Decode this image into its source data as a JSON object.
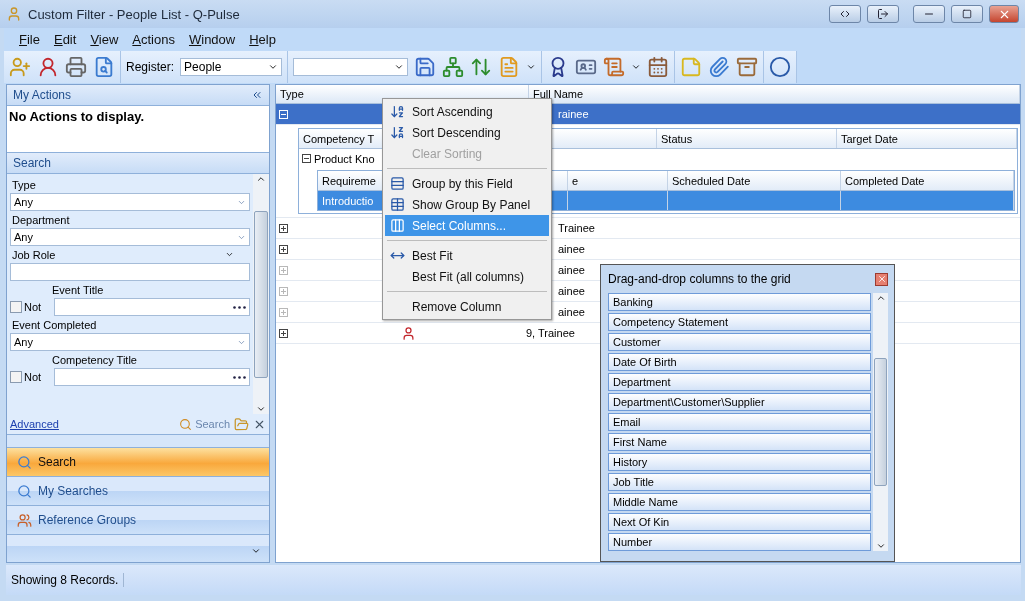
{
  "window": {
    "title": "Custom Filter - People List - Q-Pulse"
  },
  "menu": [
    {
      "label": "File"
    },
    {
      "label": "Edit"
    },
    {
      "label": "View"
    },
    {
      "label": "Actions"
    },
    {
      "label": "Window"
    },
    {
      "label": "Help"
    }
  ],
  "toolbar": {
    "register_label": "Register:",
    "register_value": "People"
  },
  "my_actions": {
    "title": "My Actions",
    "message": "No Actions to display."
  },
  "search_panel": {
    "title": "Search",
    "fields": [
      {
        "kind": "dropdown",
        "label": "Type",
        "value": "Any"
      },
      {
        "kind": "dropdown",
        "label": "Department",
        "value": "Any"
      },
      {
        "kind": "text",
        "label": "Job Role"
      },
      {
        "kind": "lookup",
        "label": "Event Title",
        "not_label": "Not",
        "not_checked": false
      },
      {
        "kind": "dropdown",
        "label": "Event Completed",
        "value": "Any"
      },
      {
        "kind": "lookup",
        "label": "Competency Title",
        "not_label": "Not",
        "not_checked": false
      }
    ],
    "advanced": "Advanced",
    "search_button": "Search"
  },
  "navigation": [
    {
      "label": "Search",
      "selected": true
    },
    {
      "label": "My Searches",
      "selected": false
    },
    {
      "label": "Reference Groups",
      "selected": false
    }
  ],
  "grid": {
    "columns": [
      "Type",
      "Full Name"
    ],
    "rows": [
      {
        "expanded": true,
        "dimmed": false,
        "selected": true,
        "full_name": "rainee"
      },
      {
        "expanded": false,
        "dimmed": false,
        "selected": false,
        "full_name": "Trainee"
      },
      {
        "expanded": false,
        "dimmed": false,
        "selected": false,
        "full_name": "ainee"
      },
      {
        "expanded": false,
        "dimmed": true,
        "selected": false,
        "full_name": "ainee"
      },
      {
        "expanded": false,
        "dimmed": true,
        "selected": false,
        "full_name": "ainee"
      },
      {
        "expanded": false,
        "dimmed": true,
        "selected": false,
        "full_name": "ainee"
      },
      {
        "expanded": false,
        "dimmed": false,
        "selected": false,
        "full_name": "9, Trainee"
      }
    ],
    "detail": {
      "columns": [
        "Competency T",
        "Status",
        "Target Date"
      ],
      "group": {
        "label": "Product Kno",
        "expanded": true
      },
      "inner_columns": [
        "Requireme",
        "e",
        "Scheduled Date",
        "Completed Date"
      ],
      "inner_rows": [
        {
          "cells": [
            "Introductio"
          ],
          "selected": true
        }
      ]
    }
  },
  "context_menu": {
    "groups": [
      [
        {
          "label": "Sort Ascending",
          "disabled": false,
          "selected": false
        },
        {
          "label": "Sort Descending",
          "disabled": false,
          "selected": false
        },
        {
          "label": "Clear Sorting",
          "disabled": true,
          "selected": false
        }
      ],
      [
        {
          "label": "Group by this Field",
          "disabled": false,
          "selected": false
        },
        {
          "label": "Show Group By Panel",
          "disabled": false,
          "selected": false
        },
        {
          "label": "Select Columns...",
          "disabled": false,
          "selected": true
        }
      ],
      [
        {
          "label": "Best Fit",
          "disabled": false,
          "selected": false
        },
        {
          "label": "Best Fit (all columns)",
          "disabled": false,
          "selected": false
        }
      ],
      [
        {
          "label": "Remove Column",
          "disabled": false,
          "selected": false
        }
      ]
    ]
  },
  "column_chooser": {
    "title": "Drag-and-drop columns to the grid",
    "columns": [
      "Banking",
      "Competency Statement",
      "Customer",
      "Date Of Birth",
      "Department",
      "Department\\Customer\\Supplier",
      "Email",
      "First Name",
      "History",
      "Job Title",
      "Middle Name",
      "Next Of Kin",
      "Number"
    ]
  },
  "status_bar": {
    "text": "Showing 8 Records."
  }
}
